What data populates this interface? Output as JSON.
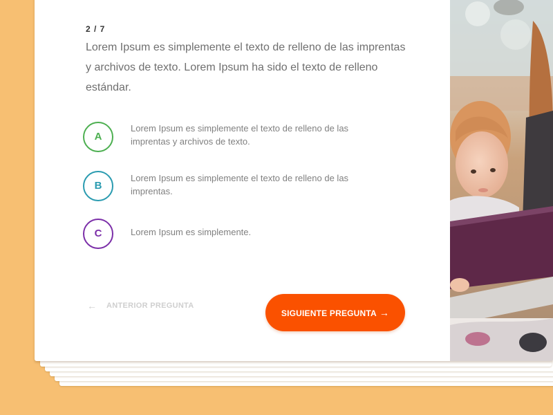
{
  "progress": {
    "label": "2 / 7",
    "current": 2,
    "total": 7
  },
  "question": {
    "text": "Lorem Ipsum es simplemente el texto de relleno de las imprentas y archivos de texto. Lorem Ipsum ha sido el texto de relleno estándar."
  },
  "options": [
    {
      "letter": "A",
      "text": "Lorem Ipsum es simplemente el texto de relleno de las imprentas y archivos de texto.",
      "color": "#4CAF50"
    },
    {
      "letter": "B",
      "text": "Lorem Ipsum es simplemente el texto de relleno de las imprentas.",
      "color": "#2A9BB0"
    },
    {
      "letter": "C",
      "text": "Lorem Ipsum es simplemente.",
      "color": "#7B2EA8"
    }
  ],
  "navigation": {
    "prev_label": "ANTERIOR PREGUNTA",
    "prev_icon": "arrow-left-icon",
    "next_label": "SIGUIENTE PREGUNTA",
    "next_icon": "arrow-right-icon"
  },
  "colors": {
    "background": "#F7BF72",
    "accent": "#FA5100",
    "question_text": "#6F6F6F",
    "disabled": "#CFCFCF"
  }
}
